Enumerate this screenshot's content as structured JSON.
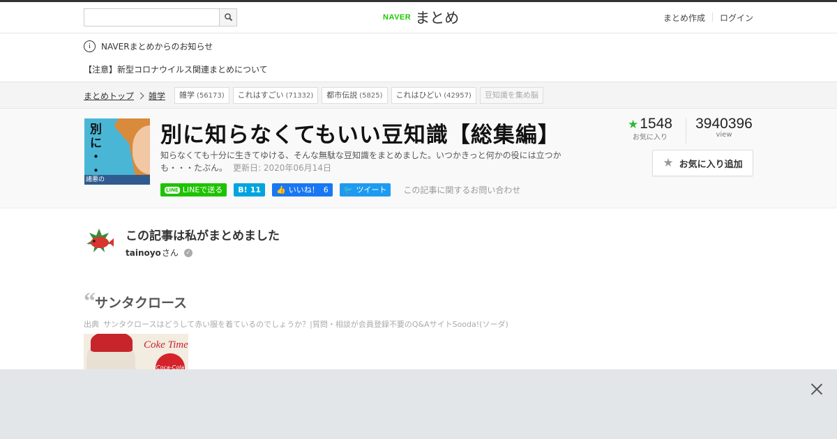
{
  "header": {
    "search_placeholder": "",
    "logo_naver": "NAVER",
    "logo_matome": "まとめ",
    "nav": [
      "まとめ作成",
      "ログイン"
    ]
  },
  "notice": {
    "info": "NAVERまとめからのお知らせ",
    "message": "【注意】新型コロナウイルス関連まとめについて"
  },
  "breadcrumb": {
    "top": "まとめトップ",
    "category": "雑学",
    "tags": [
      {
        "label": "雑学",
        "count": "(56173)"
      },
      {
        "label": "これはすごい",
        "count": "(71332)"
      },
      {
        "label": "都市伝説",
        "count": "(5825)"
      },
      {
        "label": "これはひどい",
        "count": "(42957)"
      },
      {
        "label": "豆知識を集め脳",
        "count": ""
      }
    ]
  },
  "article": {
    "thumb_text": "別\nに\n・\n・\n・",
    "thumb_band": "諸悪の",
    "title": "別に知らなくてもいい豆知識【総集編】",
    "description": "知らなくても十分に生きてゆける、そんな無駄な豆知識をまとめました。いつかきっと何かの役には立つかも・・・たぶん。",
    "updated": "更新日: 2020年06月14日",
    "share": {
      "line": "LINEで送る",
      "hatena_count": "11",
      "fb_label": "いいね！",
      "fb_count": "6",
      "tweet": "ツイート",
      "contact": "この記事に関するお問い合わせ"
    },
    "stats": {
      "favorites": "1548",
      "favorites_label": "お気に入り",
      "views": "3940396",
      "views_label": "view"
    },
    "fav_button": "お気に入り追加"
  },
  "author": {
    "heading": "この記事は私がまとめました",
    "name": "tainoyo",
    "suffix": "さん"
  },
  "section": {
    "heading": "サンタクロース",
    "source_label": "出典",
    "source_text": "サンタクロースはどうして赤い服を着ているのでしょうか？|質問・相談が会員登録不要のQ&AサイトSooda!(ソーダ)",
    "image_text": "Coke Time",
    "image_disc": "Coca-Cola"
  },
  "colors": {
    "accent_green": "#1ec800",
    "line_green": "#1dc300",
    "hatena_blue": "#00a4de",
    "fb_blue": "#1877f2",
    "twitter_blue": "#1d9bf0",
    "star_green": "#2eb835"
  }
}
